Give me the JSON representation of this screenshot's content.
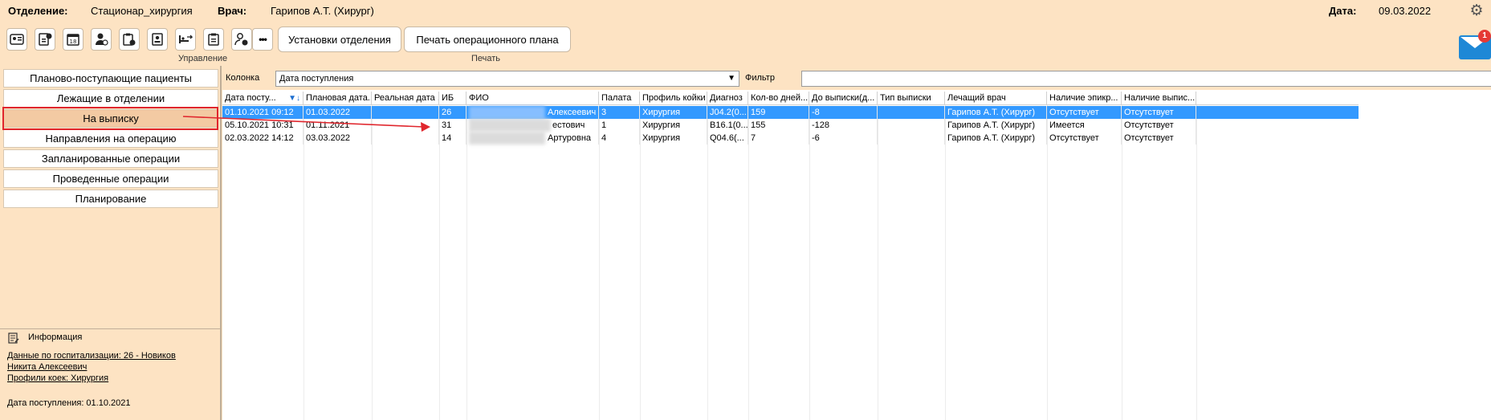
{
  "header": {
    "department_label": "Отделение:",
    "department_value": "Стационар_хирургия",
    "doctor_label": "Врач:",
    "doctor_value": "Гарипов А.Т. (Хирург)",
    "date_label": "Дата:",
    "date_value": "09.03.2022"
  },
  "toolbar": {
    "more": "•••",
    "dept_settings": "Установки отделения",
    "print_plan": "Печать операционного плана",
    "group_manage": "Управление",
    "group_print": "Печать"
  },
  "mail": {
    "badge": "1"
  },
  "sidebar": {
    "items": [
      {
        "label": "Планово-поступающие пациенты"
      },
      {
        "label": "Лежащие в отделении"
      },
      {
        "label": "На выписку"
      },
      {
        "label": "Направления на операцию"
      },
      {
        "label": "Запланированные операции"
      },
      {
        "label": "Проведенные операции"
      },
      {
        "label": "Планирование"
      }
    ]
  },
  "info": {
    "title": "Информация",
    "hosp_line1": "Данные по госпитализации: 26 - Новиков ",
    "hosp_line2": "Никита Алексеевич",
    "profiles": "Профили коек: Хирургия",
    "admission": "Дата поступления: 01.10.2021"
  },
  "filter": {
    "column_label": "Колонка",
    "column_value": "Дата поступления",
    "filter_label": "Фильтр",
    "filter_value": ""
  },
  "grid": {
    "headers": [
      "Дата посту...",
      "Плановая дата...",
      "Реальная дата ...",
      "ИБ",
      "ФИО",
      "Палата",
      "Профиль койки",
      "Диагноз",
      "Кол-во дней...",
      "До выписки(д...",
      "Тип выписки",
      "Лечащий врач",
      "Наличие эпикр...",
      "Наличие выпис..."
    ],
    "rows": [
      [
        "01.10.2021 09:12",
        "01.03.2022",
        "",
        "26",
        "Алексеевич",
        "3",
        "Хирургия",
        "J04.2(0...",
        "159",
        "-8",
        "",
        "Гарипов А.Т. (Хирург)",
        "Отсутствует",
        "Отсутствует"
      ],
      [
        "05.10.2021 10:31",
        "01.11.2021",
        "",
        "31",
        "естович",
        "1",
        "Хирургия",
        "B16.1(0...",
        "155",
        "-128",
        "",
        "Гарипов А.Т. (Хирург)",
        "Имеется",
        "Отсутствует"
      ],
      [
        "02.03.2022 14:12",
        "03.03.2022",
        "",
        "14",
        "Артуровна",
        "4",
        "Хирургия",
        "Q04.6(...",
        "7",
        "-6",
        "",
        "Гарипов А.Т. (Хирург)",
        "Отсутствует",
        "Отсутствует"
      ]
    ]
  },
  "colors": {
    "background": "#fde3c3",
    "selection": "#3399ff",
    "annotation": "#e0262d"
  }
}
